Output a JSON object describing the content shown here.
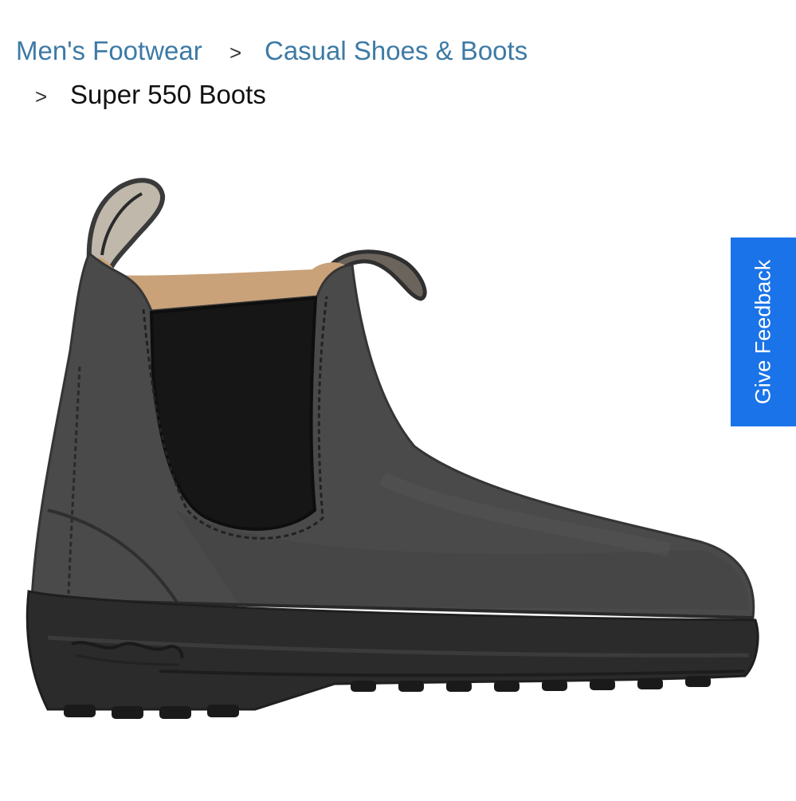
{
  "breadcrumb": {
    "items": [
      {
        "label": "Men's Footwear"
      },
      {
        "label": "Casual Shoes & Boots"
      }
    ],
    "separator": ">",
    "current": "Super 550 Boots"
  },
  "product": {
    "image_icon": "chelsea-boot-image",
    "colors": {
      "leather": "#4a4a4a",
      "elastic": "#161616",
      "sole": "#2b2b2b",
      "lining": "#c9a27a"
    }
  },
  "feedback": {
    "label": "Give Feedback",
    "color": "#1a73e8"
  }
}
